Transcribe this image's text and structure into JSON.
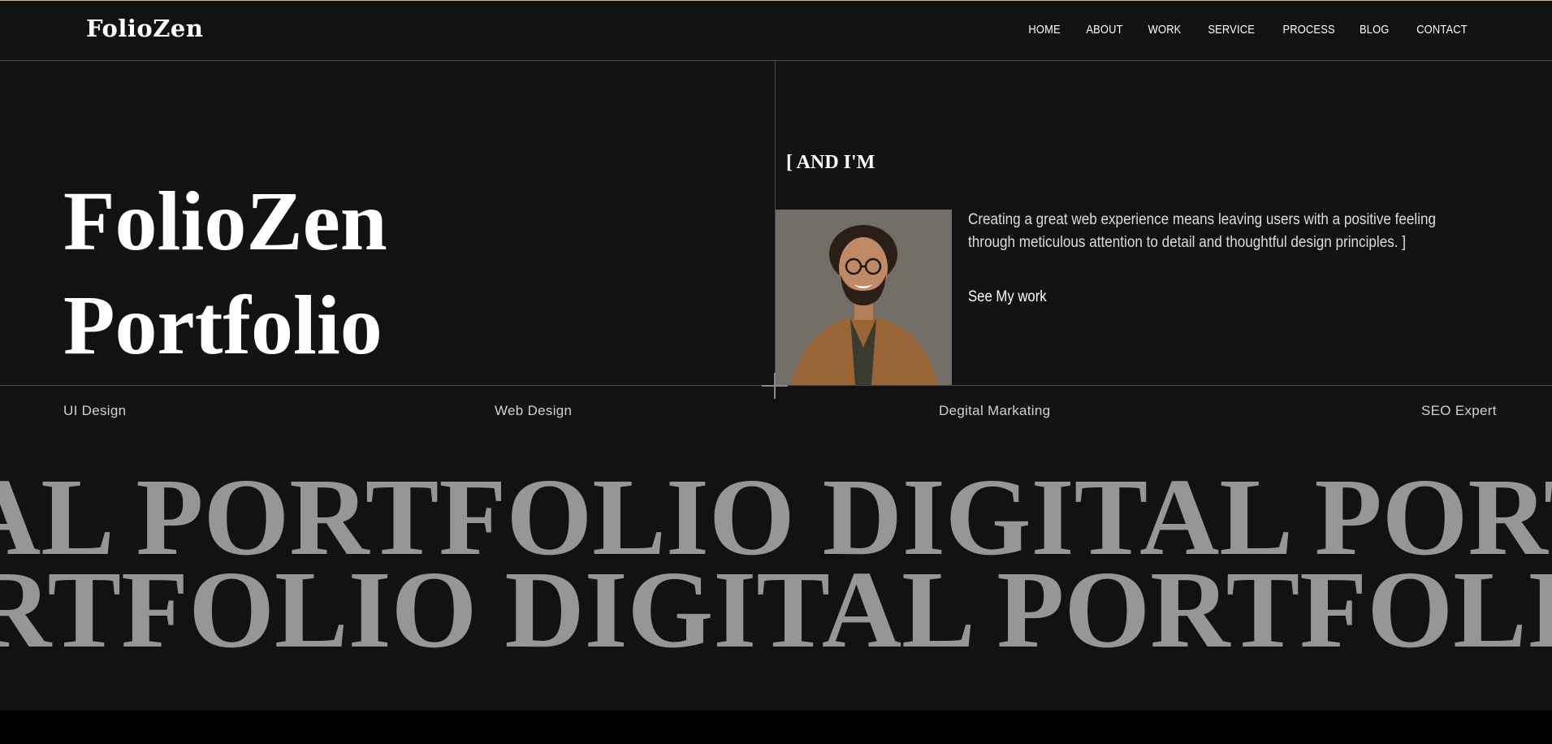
{
  "brand": "FolioZen",
  "nav": [
    "HOME",
    "ABOUT",
    "WORK",
    "SERVICE",
    "PROCESS",
    "BLOG",
    "CONTACT"
  ],
  "hero": {
    "title_line1": "FolioZen",
    "title_line2": "Portfolio",
    "intro_heading": "[ AND I'M",
    "intro_text": "Creating a great web experience means leaving users with a positive feeling through meticulous attention to detail and thoughtful design principles. ]",
    "cta_label": "See My work"
  },
  "skills": [
    "UI Design",
    "Web Design",
    "Degital Markating",
    "SEO Expert"
  ],
  "marquee": {
    "row1": "AL PORTFOLIO DIGITAL PORTFOLIO",
    "row2": "RTFOLIO  DIGITAL PORTFOLIO"
  },
  "colors": {
    "background": "#121212",
    "divider": "#4a4a4a",
    "marquee_text": "#969696"
  }
}
